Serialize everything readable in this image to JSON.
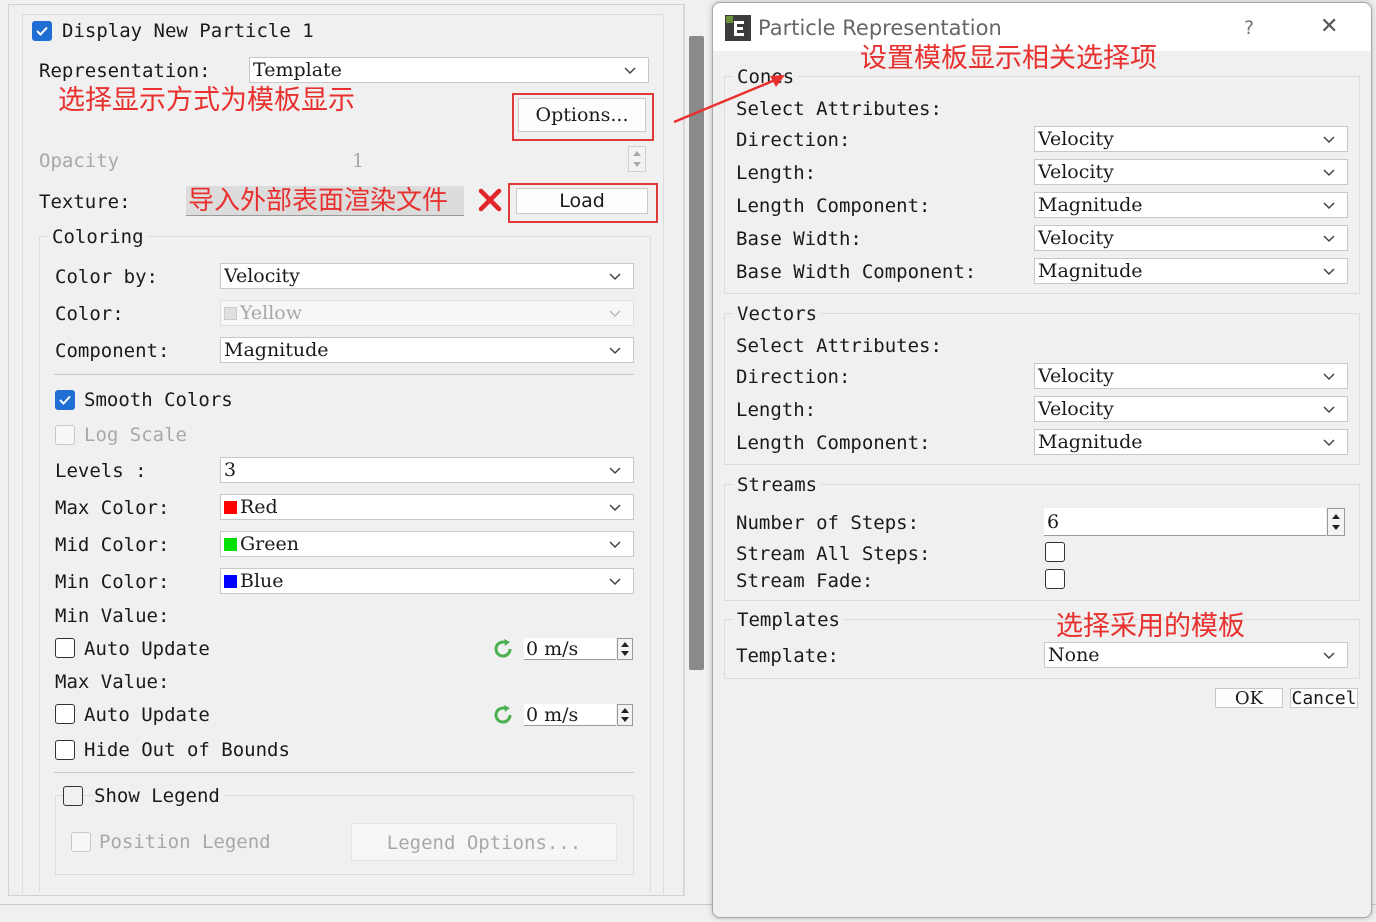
{
  "left_panel": {
    "display_label": "Display New Particle 1",
    "representation_label": "Representation:",
    "representation_value": "Template",
    "options_button": "Options...",
    "opacity_label": "Opacity",
    "opacity_value": "1",
    "texture_label": "Texture:",
    "load_button": "Load",
    "coloring": {
      "title": "Coloring",
      "color_by_label": "Color by:",
      "color_by_value": "Velocity",
      "color_label": "Color:",
      "color_value": "Yellow",
      "component_label": "Component:",
      "component_value": "Magnitude",
      "smooth_colors": "Smooth Colors",
      "log_scale": "Log Scale",
      "levels_label": "Levels :",
      "levels_value": "3",
      "max_color_label": "Max Color:",
      "max_color_value": "Red",
      "mid_color_label": "Mid Color:",
      "mid_color_value": "Green",
      "min_color_label": "Min Color:",
      "min_color_value": "Blue",
      "min_value_label": "Min Value:",
      "auto_update_1": "Auto Update",
      "min_value": "0 m/s",
      "max_value_label": "Max Value:",
      "auto_update_2": "Auto Update",
      "max_value": "0 m/s",
      "hide_out_of_bounds": "Hide Out of Bounds",
      "show_legend": "Show Legend",
      "position_legend": "Position Legend",
      "legend_options": "Legend Options..."
    }
  },
  "dialog": {
    "title": "Particle Representation",
    "help": "?",
    "close": "✕",
    "cones": {
      "title": "Cones",
      "select_attributes": "Select Attributes:",
      "direction_label": "Direction:",
      "direction_value": "Velocity",
      "length_label": "Length:",
      "length_value": "Velocity",
      "length_component_label": "Length Component:",
      "length_component_value": "Magnitude",
      "base_width_label": "Base Width:",
      "base_width_value": "Velocity",
      "base_width_component_label": "Base Width Component:",
      "base_width_component_value": "Magnitude"
    },
    "vectors": {
      "title": "Vectors",
      "select_attributes": "Select Attributes:",
      "direction_label": "Direction:",
      "direction_value": "Velocity",
      "length_label": "Length:",
      "length_value": "Velocity",
      "length_component_label": "Length Component:",
      "length_component_value": "Magnitude"
    },
    "streams": {
      "title": "Streams",
      "steps_label": "Number of Steps:",
      "steps_value": "6",
      "stream_all_label": "Stream All Steps:",
      "stream_fade_label": "Stream Fade:"
    },
    "templates": {
      "title": "Templates",
      "template_label": "Template:",
      "template_value": "None"
    },
    "ok": "OK",
    "cancel": "Cancel"
  },
  "annotations": {
    "representation_note": "选择显示方式为模板显示",
    "texture_note": "导入外部表面渲染文件",
    "dialog_note": "设置模板显示相关选择项",
    "template_note": "选择采用的模板"
  },
  "colors": {
    "annotation": "#e8302f",
    "checkbox_checked": "#1f6ed4",
    "swatch_red": "#ff0000",
    "swatch_green": "#00e000",
    "swatch_blue": "#0000ff"
  }
}
